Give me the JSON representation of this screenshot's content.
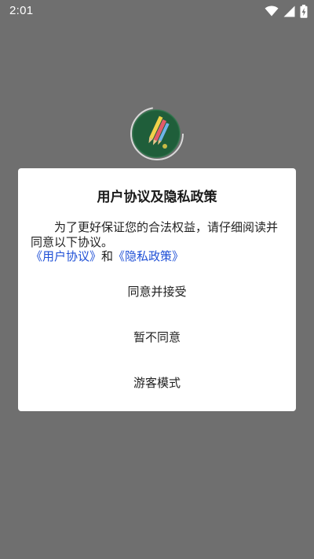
{
  "status_bar": {
    "time": "2:01",
    "icons": [
      "wifi-icon",
      "cellular-signal-icon",
      "battery-charging-icon"
    ]
  },
  "logo": {
    "icon": "app-logo-pencils-icon",
    "colors": {
      "circle": "#1f5e3a",
      "ring": "#d9d9d9"
    }
  },
  "dialog": {
    "title": "用户协议及隐私政策",
    "body": "为了更好保证您的合法权益，请仔细阅读并同意以下协议。",
    "links": {
      "user_agreement": "《用户协议》",
      "conjunction": "和",
      "privacy_policy": "《隐私政策》"
    },
    "buttons": {
      "accept": "同意并接受",
      "decline": "暂不同意",
      "guest": "游客模式"
    },
    "colors": {
      "link": "#1e4fd6",
      "overlay": "#6f6f6f"
    }
  }
}
